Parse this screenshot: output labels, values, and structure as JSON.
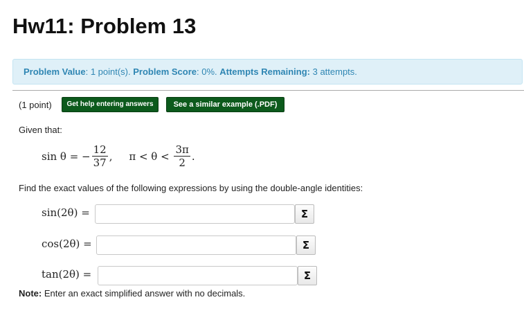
{
  "page": {
    "title": "Hw11: Problem 13"
  },
  "status": {
    "value_label": "Problem Value",
    "value_text": ": 1 point(s). ",
    "score_label": "Problem Score",
    "score_text": ": 0%. ",
    "attempts_label": "Attempts Remaining:",
    "attempts_text": " 3 attempts."
  },
  "problem": {
    "points": "(1 point)",
    "help_button": "Get help entering answers",
    "example_button": "See a similar example (.PDF)",
    "given": "Given that:",
    "given_lhs": "sin θ = −",
    "given_num": "12",
    "given_den": "37",
    "given_mid": ",     π < θ < ",
    "given_num2": "3π",
    "given_den2": "2",
    "given_end": ".",
    "instruction": "Find the exact values of the following expressions by using the double-angle identities:",
    "answers": [
      {
        "label": "sin(2θ) =",
        "value": ""
      },
      {
        "label": "cos(2θ) =",
        "value": ""
      },
      {
        "label": "tan(2θ) =",
        "value": ""
      }
    ],
    "sigma": "Σ",
    "note_label": "Note:",
    "note_text": " Enter an exact simplified answer with no decimals."
  }
}
